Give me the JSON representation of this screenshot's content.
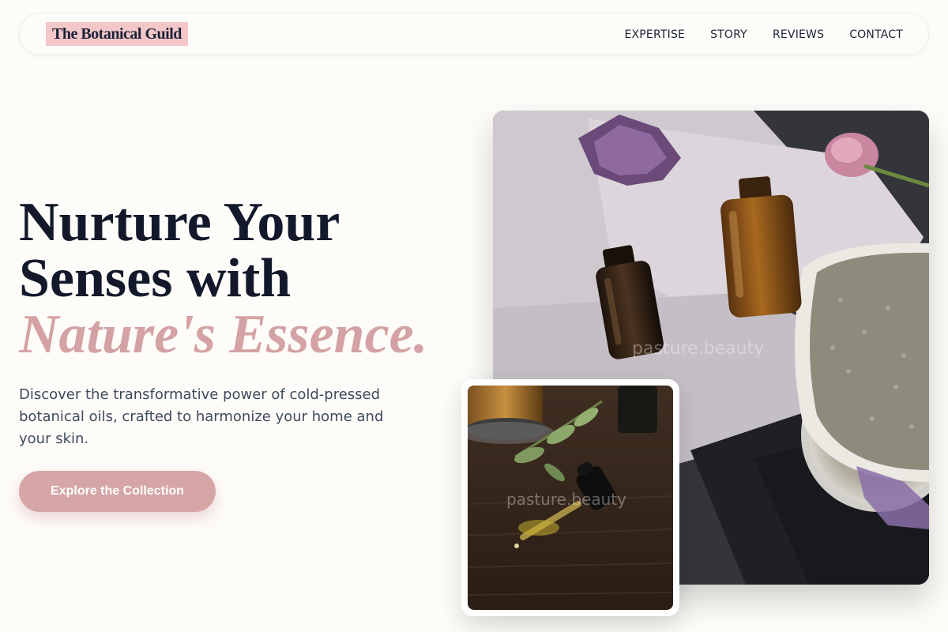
{
  "brand": {
    "name": "The Botanical Guild",
    "highlight_color": "#f3c6c8"
  },
  "nav": {
    "items": [
      {
        "label": "EXPERTISE"
      },
      {
        "label": "STORY"
      },
      {
        "label": "REVIEWS"
      },
      {
        "label": "CONTACT"
      }
    ]
  },
  "hero": {
    "headline_line1": "Nurture Your",
    "headline_line2": "Senses with",
    "headline_accent": "Nature's Essence.",
    "accent_color": "#d4a2a4",
    "description": "Discover the transformative power of cold-pressed botanical oils, crafted to harmonize your home and your skin.",
    "cta_label": "Explore the Collection"
  },
  "images": {
    "main": {
      "subject": "amber-oil-bottles-linen-lavender-photo",
      "watermark": "pasture.beauty"
    },
    "secondary": {
      "subject": "dropper-oil-on-wood-photo",
      "watermark": "pasture.beauty"
    }
  }
}
